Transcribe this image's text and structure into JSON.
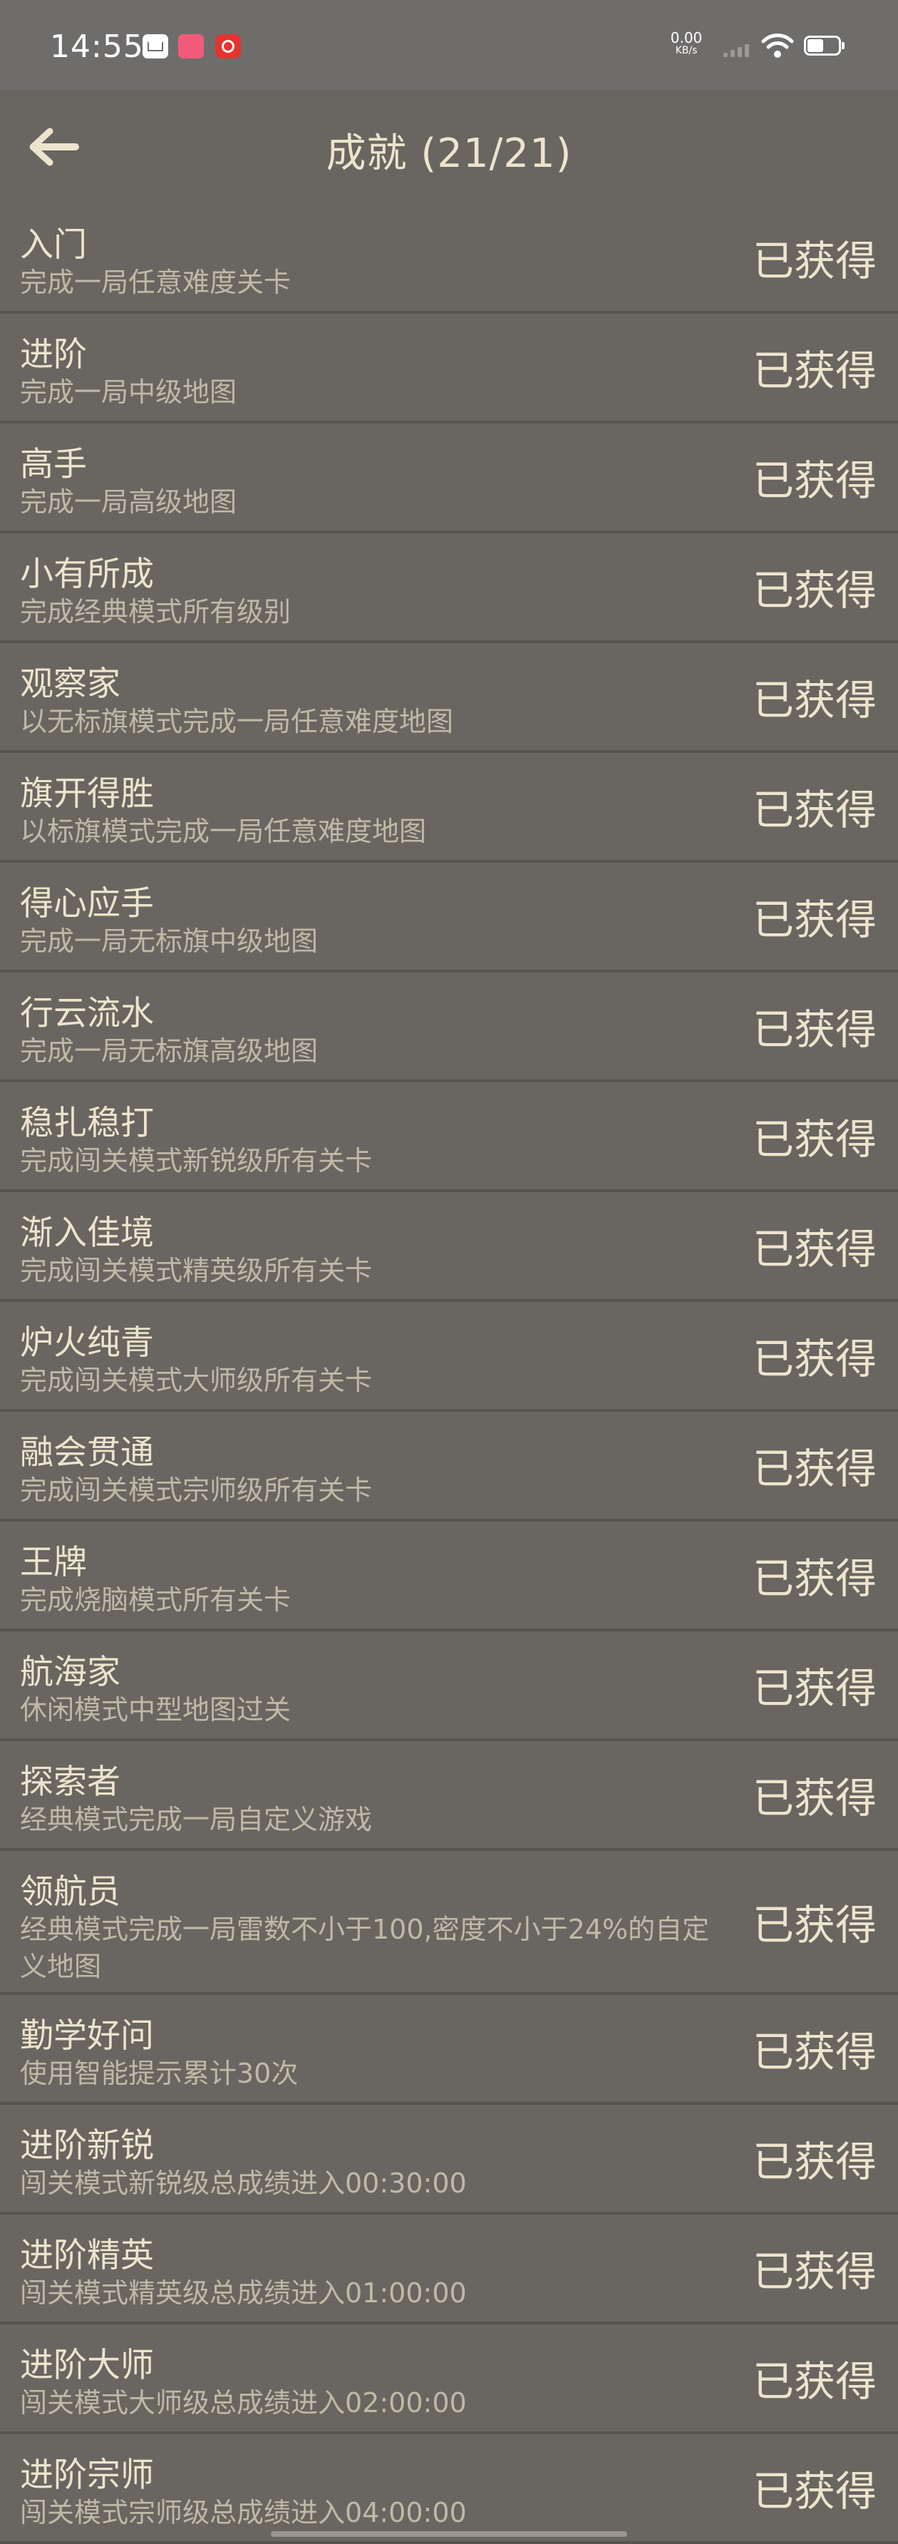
{
  "status_bar": {
    "time": "14:55",
    "net_speed_value": "0.00",
    "net_speed_unit": "KB/s",
    "battery_level": 0.55,
    "icons": [
      "mail-icon",
      "app-notification-icon",
      "netease-music-icon",
      "signal-icon",
      "wifi-icon",
      "battery-icon"
    ]
  },
  "header": {
    "back_icon": "arrow-left-icon",
    "title": "成就 (21/21)"
  },
  "colors": {
    "background": "#696560",
    "status_bar": "#6f6d6b",
    "divider": "#57534f",
    "text_primary": "#ece4cd",
    "text_secondary": "#c0b9a7"
  },
  "achievements": [
    {
      "name": "入门",
      "description": "完成一局任意难度关卡",
      "status": "已获得"
    },
    {
      "name": "进阶",
      "description": "完成一局中级地图",
      "status": "已获得"
    },
    {
      "name": "高手",
      "description": "完成一局高级地图",
      "status": "已获得"
    },
    {
      "name": "小有所成",
      "description": "完成经典模式所有级别",
      "status": "已获得"
    },
    {
      "name": "观察家",
      "description": "以无标旗模式完成一局任意难度地图",
      "status": "已获得"
    },
    {
      "name": "旗开得胜",
      "description": "以标旗模式完成一局任意难度地图",
      "status": "已获得"
    },
    {
      "name": "得心应手",
      "description": "完成一局无标旗中级地图",
      "status": "已获得"
    },
    {
      "name": "行云流水",
      "description": "完成一局无标旗高级地图",
      "status": "已获得"
    },
    {
      "name": "稳扎稳打",
      "description": "完成闯关模式新锐级所有关卡",
      "status": "已获得"
    },
    {
      "name": "渐入佳境",
      "description": "完成闯关模式精英级所有关卡",
      "status": "已获得"
    },
    {
      "name": "炉火纯青",
      "description": "完成闯关模式大师级所有关卡",
      "status": "已获得"
    },
    {
      "name": "融会贯通",
      "description": "完成闯关模式宗师级所有关卡",
      "status": "已获得"
    },
    {
      "name": "王牌",
      "description": "完成烧脑模式所有关卡",
      "status": "已获得"
    },
    {
      "name": "航海家",
      "description": "休闲模式中型地图过关",
      "status": "已获得"
    },
    {
      "name": "探索者",
      "description": "经典模式完成一局自定义游戏",
      "status": "已获得"
    },
    {
      "name": "领航员",
      "description": "经典模式完成一局雷数不小于100,密度不小于24%的自定义地图",
      "status": "已获得"
    },
    {
      "name": "勤学好问",
      "description": "使用智能提示累计30次",
      "status": "已获得"
    },
    {
      "name": "进阶新锐",
      "description": "闯关模式新锐级总成绩进入00:30:00",
      "status": "已获得"
    },
    {
      "name": "进阶精英",
      "description": "闯关模式精英级总成绩进入01:00:00",
      "status": "已获得"
    },
    {
      "name": "进阶大师",
      "description": "闯关模式大师级总成绩进入02:00:00",
      "status": "已获得"
    },
    {
      "name": "进阶宗师",
      "description": "闯关模式宗师级总成绩进入04:00:00",
      "status": "已获得"
    }
  ]
}
